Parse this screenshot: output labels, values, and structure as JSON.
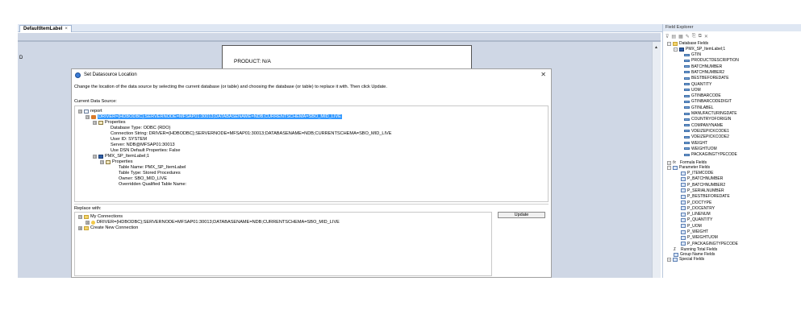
{
  "document_tab": {
    "label": "DefaultItemLabel",
    "close": "×"
  },
  "design": {
    "marker": "D",
    "product_label": "PRODUCT: N/A",
    "scroll_up": "▲"
  },
  "dialog": {
    "title": "Set Datasource Location",
    "close": "✕",
    "description": "Change the location of the data source by selecting the current database (or table) and choosing the database (or table) to replace it with.  Then click Update.",
    "current_label": "Current Data Source:",
    "current_tree": [
      {
        "text": "report",
        "expander": "⊟",
        "icon": "report-icon"
      },
      {
        "text": "DRIVER={HDBODBC};SERVERNODE=MFSAP01:30013;DATABASENAME=NDB;CURRENTSCHEMA=SBO_MID_LIVE",
        "expander": "⊟",
        "icon": "database-icon"
      },
      {
        "text": "Properties",
        "expander": "⊟",
        "icon": "properties-icon"
      },
      {
        "text": "Database Type: ODBC (RDO)"
      },
      {
        "text": "Connection String: DRIVER={HDBODBC};SERVERNODE=MFSAP01:30013;DATABASENAME=NDB;CURRENTSCHEMA=SBO_MID_LIVE"
      },
      {
        "text": "User ID: SYSTEM"
      },
      {
        "text": "Server: NDB@MFSAP01:30013"
      },
      {
        "text": "Use DSN Default Properties: False"
      },
      {
        "text": "PMX_SP_ItemLabel;1",
        "expander": "⊟",
        "icon": "table-icon"
      },
      {
        "text": "Properties",
        "expander": "⊟",
        "icon": "properties-icon"
      },
      {
        "text": "Table Name: PMX_SP_ItemLabel"
      },
      {
        "text": "Table Type: Stored Procedures"
      },
      {
        "text": "Owner: SBO_MID_LIVE"
      },
      {
        "text": "Overridden Qualified Table Name:"
      }
    ],
    "replace_label": "Replace with:",
    "replace_tree": [
      {
        "text": "My Connections",
        "expander": "⊟",
        "icon": "folder-icon"
      },
      {
        "text": "DRIVER={HDBODBC};SERVERNODE=MFSAP01:30013;DATABASENAME=NDB;CURRENTSCHEMA=SBO_MID_LIVE",
        "expander": "⊞",
        "icon": "connection-icon"
      },
      {
        "text": "Create New Connection",
        "expander": "⊞",
        "icon": "folder-icon"
      }
    ],
    "update_button": "Update"
  },
  "field_explorer": {
    "title": "Field Explorer",
    "toolbar": [
      "⊽",
      "▤",
      "▦",
      "✎",
      "⎘",
      "⧉",
      "✕"
    ],
    "database_fields": "Database Fields",
    "table": "PMX_SP_ItemLabel;1",
    "fields": [
      "GTIN",
      "PRODUCTDESCRIPTION",
      "BATCHNUMBER",
      "BATCHNUMBER2",
      "BESTBEFOREDATE",
      "QUANTITY",
      "UOM",
      "GTINBARCODE",
      "GTINBARCODEDIGIT",
      "GTINLABEL",
      "MANUFACTURINGDATE",
      "COUNTRYOFORIGIN",
      "COMPANYNAME",
      "VDEIZEPICKCODE1",
      "VDEIZEPICKCODE2",
      "WEIGHT",
      "WEIGHTUOM",
      "PACKAGINGTYPECODE"
    ],
    "formula_fields": "Formula Fields",
    "parameter_fields": "Parameter Fields",
    "parameters": [
      "P_ITEMCODE",
      "P_BATCHNUMBER",
      "P_BATCHNUMBER2",
      "P_SERIALNUMBER",
      "P_BESTBEFOREDATE",
      "P_DOCTYPE",
      "P_DOCENTRY",
      "P_LINENUM",
      "P_QUANTITY",
      "P_UOM",
      "P_WEIGHT",
      "P_WEIGHTUOM",
      "P_PACKAGINGTYPECODE"
    ],
    "running_total_fields": "Running Total Fields",
    "group_name_fields": "Group Name Fields",
    "special_fields": "Special Fields"
  }
}
